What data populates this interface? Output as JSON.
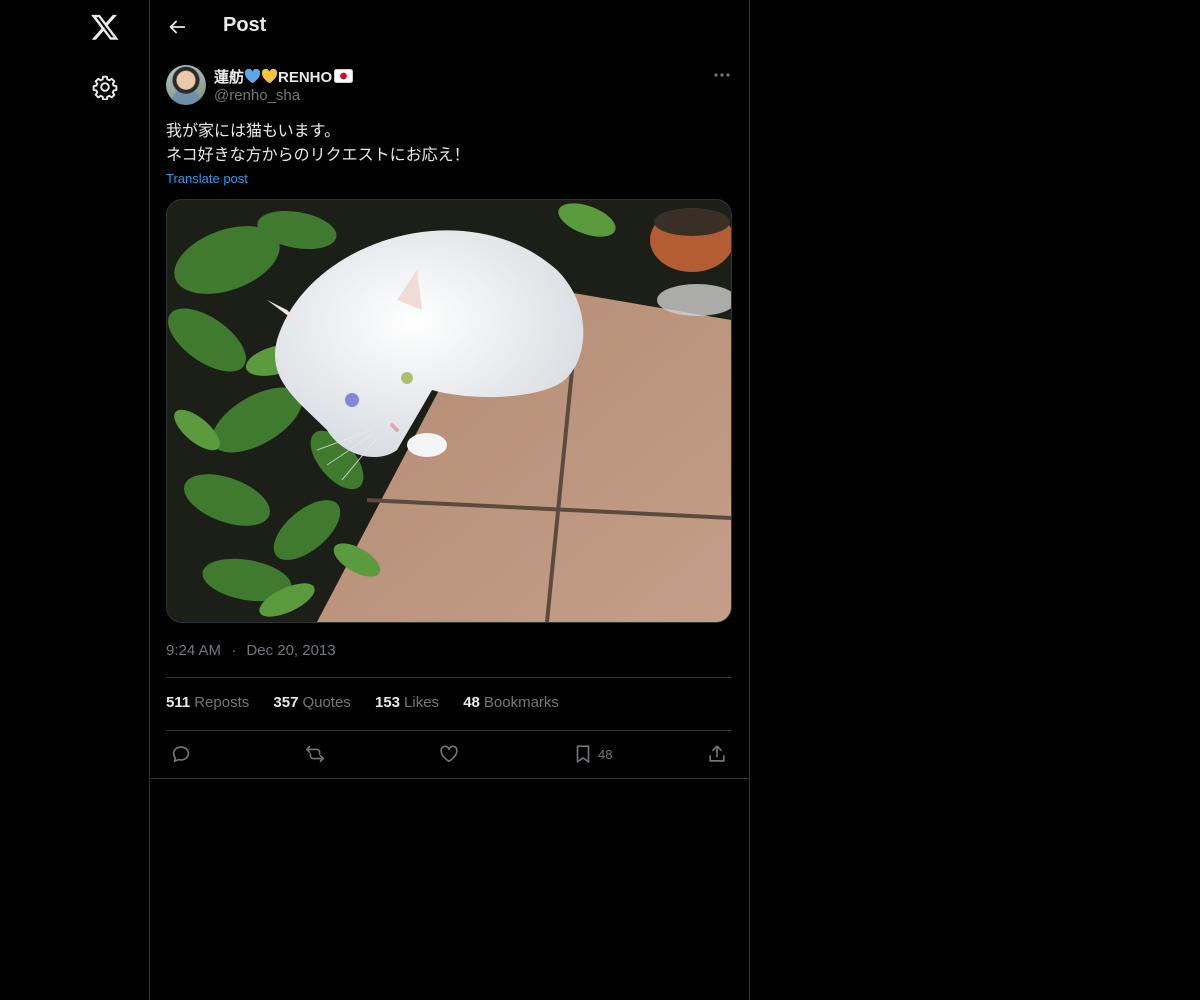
{
  "nav": {
    "logo_icon": "x-logo-icon",
    "settings_icon": "gear-icon"
  },
  "header": {
    "back_icon": "arrow-left-icon",
    "title": "Post"
  },
  "post": {
    "author_name_prefix": "蓮舫",
    "author_name_suffix": "RENHO",
    "author_handle": "@renho_sha",
    "text_lines": [
      "我が家には猫もいます。",
      "ネコ好きな方からのリクエストにお応え！"
    ],
    "translate_label": "Translate post",
    "image_alt": "white cat sitting on tiles next to plants",
    "time": "9:24 AM",
    "separator": "·",
    "date": "Dec 20, 2013"
  },
  "stats": {
    "reposts": {
      "count": "511",
      "label": "Reposts"
    },
    "quotes": {
      "count": "357",
      "label": "Quotes"
    },
    "likes": {
      "count": "153",
      "label": "Likes"
    },
    "bookmarks": {
      "count": "48",
      "label": "Bookmarks"
    }
  },
  "actions": {
    "bookmark_count": "48"
  },
  "colors": {
    "background": "#000000",
    "text": "#e7e9ea",
    "muted": "#71767b",
    "link": "#1d9bf0",
    "border": "#2f3336"
  }
}
